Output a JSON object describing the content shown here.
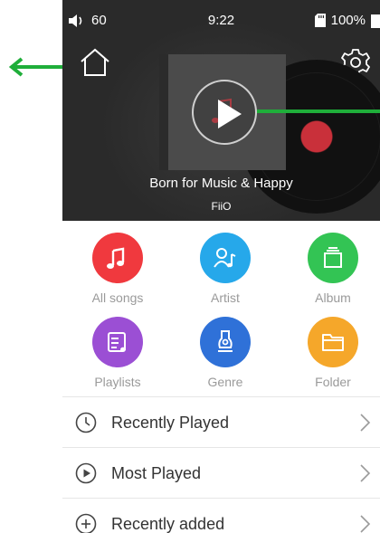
{
  "status_bar": {
    "volume": "60",
    "time": "9:22",
    "battery": "100%"
  },
  "header": {
    "home_icon": "home-icon",
    "settings_icon": "gear-icon"
  },
  "now_playing": {
    "title": "Born for Music & Happy",
    "artist": "FiiO"
  },
  "categories": [
    {
      "label": "All songs",
      "color": "#f0393e",
      "icon": "music-note-icon"
    },
    {
      "label": "Artist",
      "color": "#26a8ea",
      "icon": "artist-icon"
    },
    {
      "label": "Album",
      "color": "#33c454",
      "icon": "album-icon"
    },
    {
      "label": "Playlists",
      "color": "#9b4fd4",
      "icon": "playlist-icon"
    },
    {
      "label": "Genre",
      "color": "#2f71d8",
      "icon": "genre-icon"
    },
    {
      "label": "Folder",
      "color": "#f5a72a",
      "icon": "folder-icon"
    }
  ],
  "lists": [
    {
      "label": "Recently Played",
      "icon": "clock-icon"
    },
    {
      "label": "Most Played",
      "icon": "play-circle-icon"
    },
    {
      "label": "Recently added",
      "icon": "plus-circle-icon"
    }
  ],
  "colors": {
    "header_bg": "#2a2a2a",
    "annotation_arrow": "#1fae3a"
  }
}
